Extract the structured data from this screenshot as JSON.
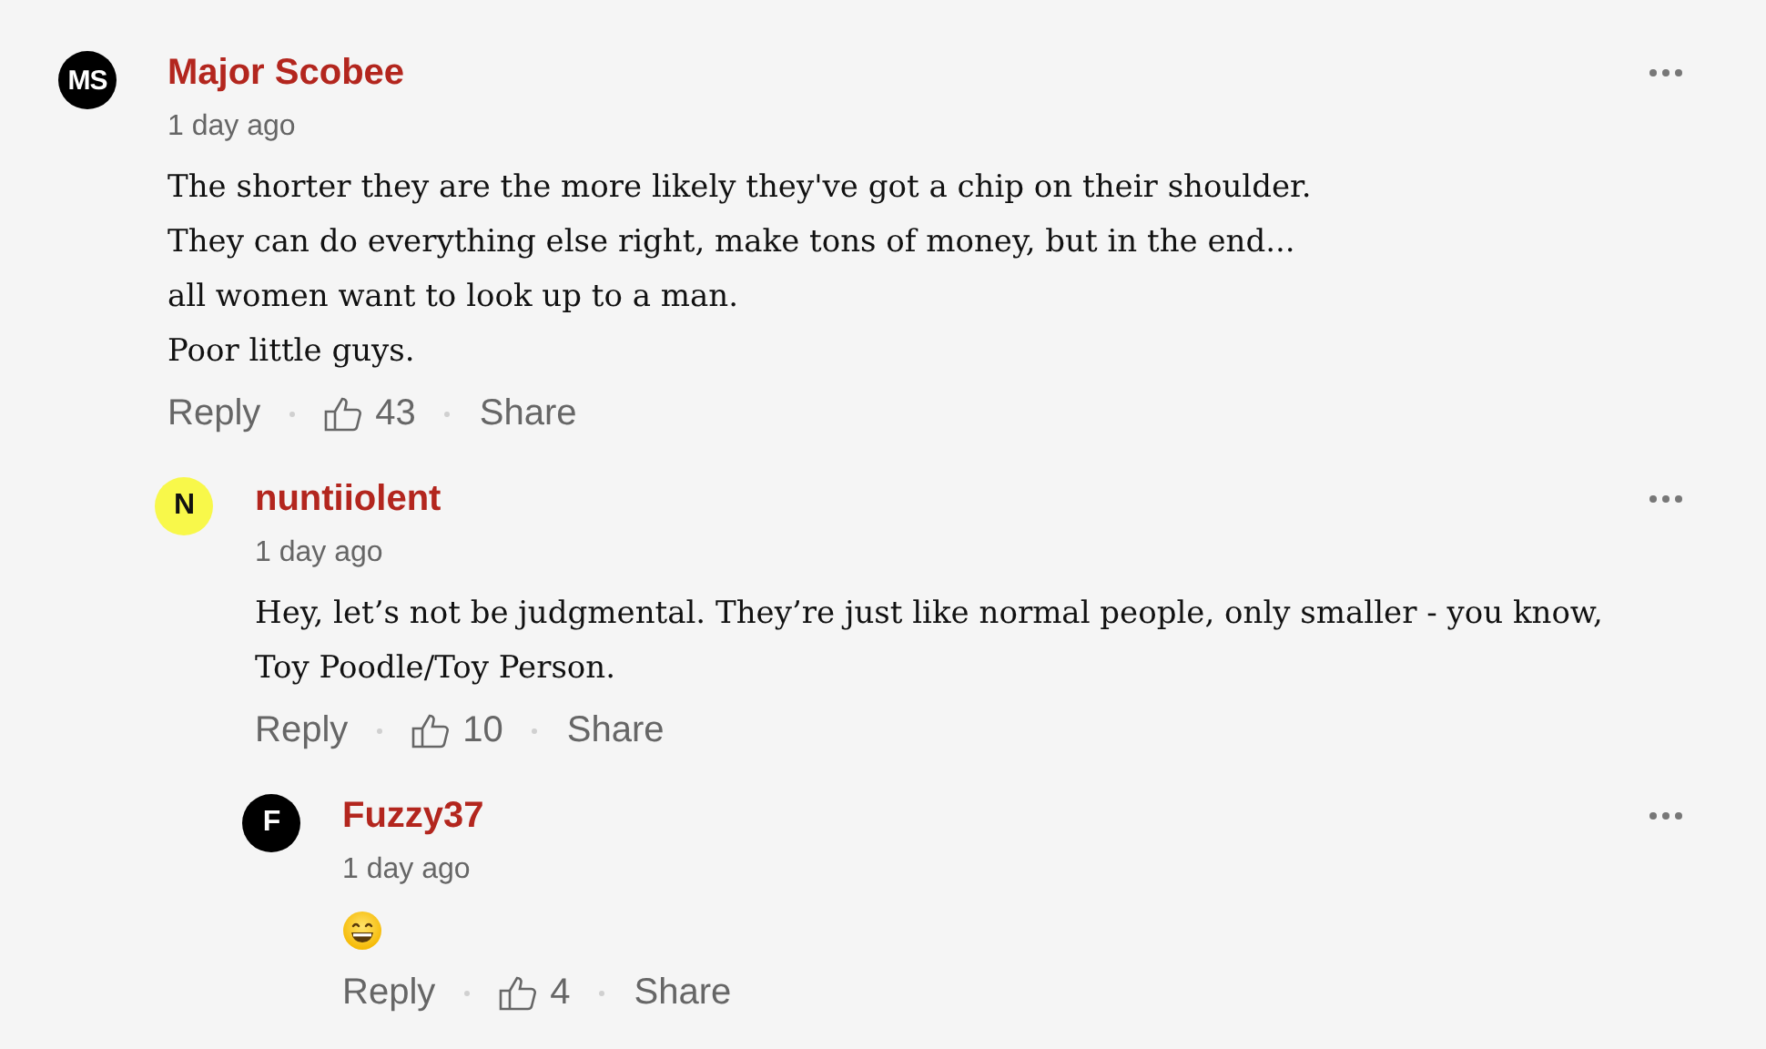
{
  "comments": [
    {
      "initials": "MS",
      "color": "#000000",
      "author": "Major Scobee",
      "time": "1 day ago",
      "content": {
        "kind": "text",
        "lines": [
          "The shorter they are the more likely they've got a chip on their shoulder.",
          "They can do everything else right, make tons of money, but in the end...",
          "all women want to look up to a man.",
          "Poor little guys."
        ]
      },
      "actions": {
        "reply": "Reply",
        "likes": "43",
        "share": "Share"
      },
      "children": [
        {
          "initials": "N",
          "color": "#f8f84a",
          "author": "nuntiiolent",
          "time": "1 day ago",
          "content": {
            "kind": "text",
            "lines": [
              "Hey, let’s not be judgmental. They’re just like normal people, only smaller - you know,",
              "Toy Poodle/Toy Person."
            ]
          },
          "actions": {
            "reply": "Reply",
            "likes": "10",
            "share": "Share"
          },
          "children": [
            {
              "initials": "F",
              "color": "#000000",
              "author": "Fuzzy37",
              "time": "1 day ago",
              "content": {
                "kind": "emoji"
              },
              "actions": {
                "reply": "Reply",
                "likes": "4",
                "share": "Share"
              }
            }
          ]
        }
      ]
    }
  ]
}
